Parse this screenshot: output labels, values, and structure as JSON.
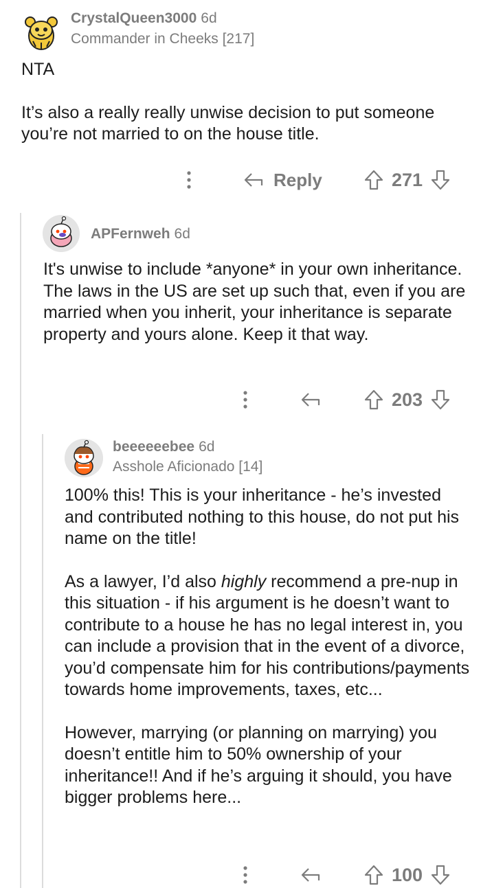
{
  "comments": [
    {
      "username": "CrystalQueen3000",
      "time": "6d",
      "flair": "Commander in Cheeks [217]",
      "paragraphs": [
        "NTA",
        "It’s also a really really unwise decision to put someone you’re not married to on the house title."
      ],
      "reply_label": "Reply",
      "score": "271"
    },
    {
      "username": "APFernweh",
      "time": "6d",
      "paragraphs": [
        "It's unwise to include *anyone* in your own inheritance. The laws in the US are set up such that, even if you are married when you inherit, your inheritance is separate property and yours alone. Keep it that way."
      ],
      "score": "203"
    },
    {
      "username": "beeeeeebee",
      "time": "6d",
      "flair": "Asshole Aficionado [14]",
      "paragraphs": [
        "100% this!  This is your inheritance - he’s invested and contributed nothing to this house, do not put his name on the title!",
        "As a lawyer, I’d also",
        "highly",
        "recommend a pre-nup in this situation - if his argument is he doesn’t want to contribute to a house he has no legal interest in, you can include a provision that in the event of a divorce, you’d compensate him for his contributions/payments towards home improvements, taxes, etc...",
        "However, marrying (or planning on marrying) you doesn’t entitle him to 50% ownership of your inheritance!! And if he’s arguing it should, you have bigger problems here..."
      ],
      "score": "100"
    }
  ],
  "icons": {
    "more": "more-vertical-icon",
    "reply": "reply-arrow-icon",
    "upvote": "upvote-arrow-icon",
    "downvote": "downvote-arrow-icon"
  },
  "colors": {
    "meta_text": "#7c7c7c",
    "body_text": "#1c1c1c",
    "thread_line": "#dcdcdc"
  }
}
